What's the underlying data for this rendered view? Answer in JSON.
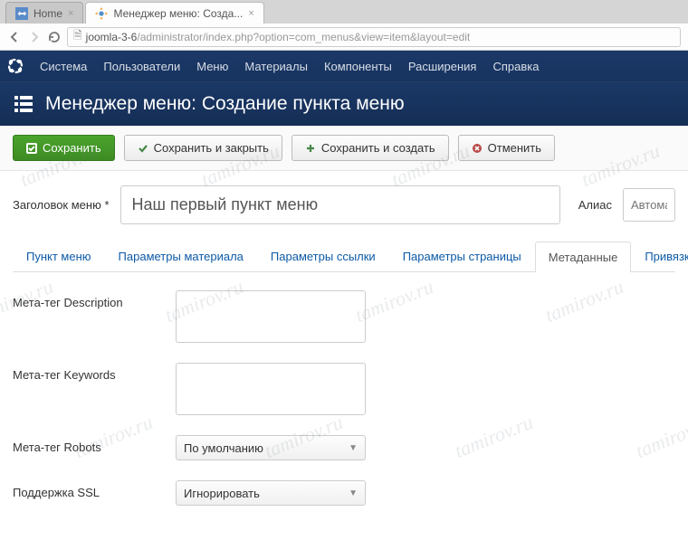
{
  "browser": {
    "tabs": [
      {
        "label": "Home"
      },
      {
        "label": "Менеджер меню: Созда..."
      }
    ],
    "url_host": "joomla-3-6",
    "url_path": "/administrator/index.php",
    "url_query": "?option=com_menus&view=item&layout=edit"
  },
  "joomla_menu": [
    "Система",
    "Пользователи",
    "Меню",
    "Материалы",
    "Компоненты",
    "Расширения",
    "Справка"
  ],
  "page_title": "Менеджер меню: Создание пункта меню",
  "toolbar": {
    "save": "Сохранить",
    "save_close": "Сохранить и закрыть",
    "save_new": "Сохранить и создать",
    "cancel": "Отменить"
  },
  "form": {
    "title_label": "Заголовок меню *",
    "title_value": "Наш первый пункт меню",
    "alias_label": "Алиас",
    "alias_placeholder": "Автомат"
  },
  "tabs": [
    "Пункт меню",
    "Параметры материала",
    "Параметры ссылки",
    "Параметры страницы",
    "Метаданные",
    "Привязка модулей"
  ],
  "active_tab": "Метаданные",
  "fields": {
    "meta_desc": "Мета-тег Description",
    "meta_keywords": "Мета-тег Keywords",
    "meta_robots_label": "Мета-тег Robots",
    "meta_robots_value": "По умолчанию",
    "ssl_label": "Поддержка SSL",
    "ssl_value": "Игнорировать"
  },
  "watermark": "tamirov.ru"
}
